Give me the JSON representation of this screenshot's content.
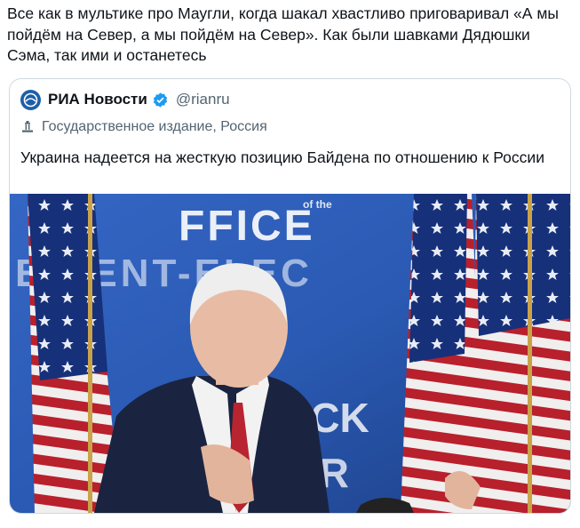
{
  "tweet": {
    "text": "Все как в мультике про Маугли, когда шакал хвастливо приговаривал «А мы пойдём на Север, а мы пойдём на Север». Как были шавками Дядюшки Сэма, так ими и останетесь"
  },
  "quote": {
    "display_name": "РИА Новости",
    "handle": "@rianru",
    "label": "Государственное издание, Россия",
    "text": "Украина надеется на жесткую позицию Байдена по отношению к России",
    "verified": true,
    "avatar_icon": "ria-logo-icon",
    "label_icon": "government-building-icon"
  },
  "photo": {
    "backdrop_text_line1": "FFICE",
    "backdrop_text_line1_small": "of the",
    "backdrop_text_line2": "E  DENT-ELEC",
    "backdrop_text_line4": "ACK",
    "backdrop_text_line5": "ER"
  },
  "colors": {
    "backdrop_blue": "#2a5fb8",
    "verified_blue": "#1d9bf0",
    "border": "#cfd9de",
    "secondary_text": "#536471"
  }
}
